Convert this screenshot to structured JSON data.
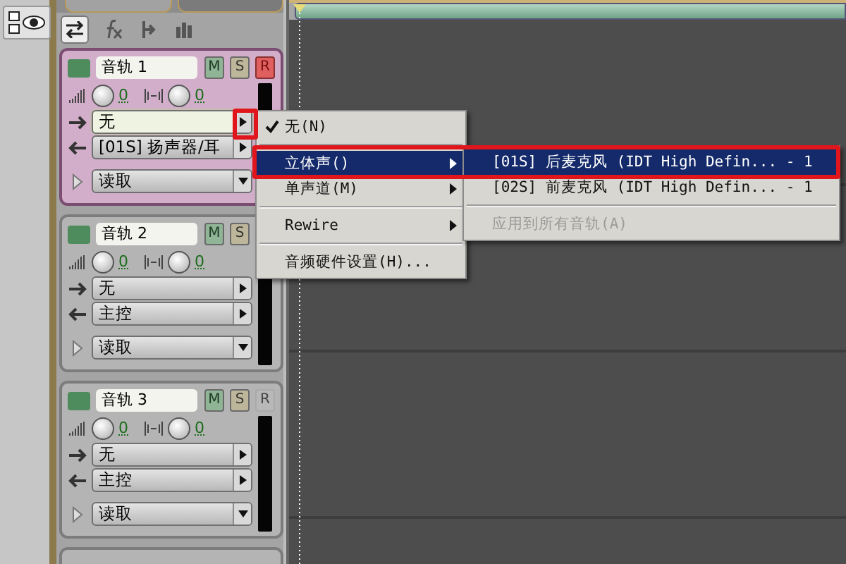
{
  "panel_tabs": [
    {
      "selected": true
    },
    {
      "selected": false
    }
  ],
  "toolbar": [
    {
      "kind": "swap",
      "selected": true
    },
    {
      "kind": "fx",
      "selected": false
    },
    {
      "kind": "send",
      "selected": false
    },
    {
      "kind": "eq",
      "selected": false
    }
  ],
  "tracks": [
    {
      "name": "音轨 1",
      "mute": "M",
      "solo": "S",
      "record": "R",
      "selected": true,
      "armed": true,
      "volume": "0",
      "pan": "0",
      "input": "无",
      "output": "[01S] 扬声器/耳",
      "automation": "读取"
    },
    {
      "name": "音轨 2",
      "mute": "M",
      "solo": "S",
      "selected": false,
      "volume": "0",
      "pan": "0",
      "input": "无",
      "output": "主控",
      "automation": "读取"
    },
    {
      "name": "音轨 3",
      "mute": "M",
      "solo": "S",
      "record": "R",
      "selected": false,
      "armed": false,
      "volume": "0",
      "pan": "0",
      "input": "无",
      "output": "主控",
      "automation": "读取"
    },
    {
      "selected": false
    }
  ],
  "menu": {
    "items": [
      {
        "kind": "check",
        "label": "无(N)",
        "checked": true,
        "selected": false
      },
      {
        "kind": "separator"
      },
      {
        "kind": "submenu",
        "label": "立体声()",
        "selected": true
      },
      {
        "kind": "submenu",
        "label": "单声道(M)",
        "selected": false
      },
      {
        "kind": "separator"
      },
      {
        "kind": "submenu",
        "label": "Rewire",
        "selected": false
      },
      {
        "kind": "separator"
      },
      {
        "kind": "item",
        "label": "音频硬件设置(H)...",
        "selected": false
      }
    ]
  },
  "submenu": {
    "items": [
      {
        "kind": "item",
        "label": "[01S] 后麦克风 (IDT High Defin... - 1",
        "selected": true,
        "disabled": false
      },
      {
        "kind": "item",
        "label": "[02S] 前麦克风 (IDT High Defin... - 1",
        "selected": false,
        "disabled": false
      },
      {
        "kind": "separator"
      },
      {
        "kind": "item",
        "label": "应用到所有音轨(A)",
        "selected": false,
        "disabled": true
      }
    ]
  }
}
